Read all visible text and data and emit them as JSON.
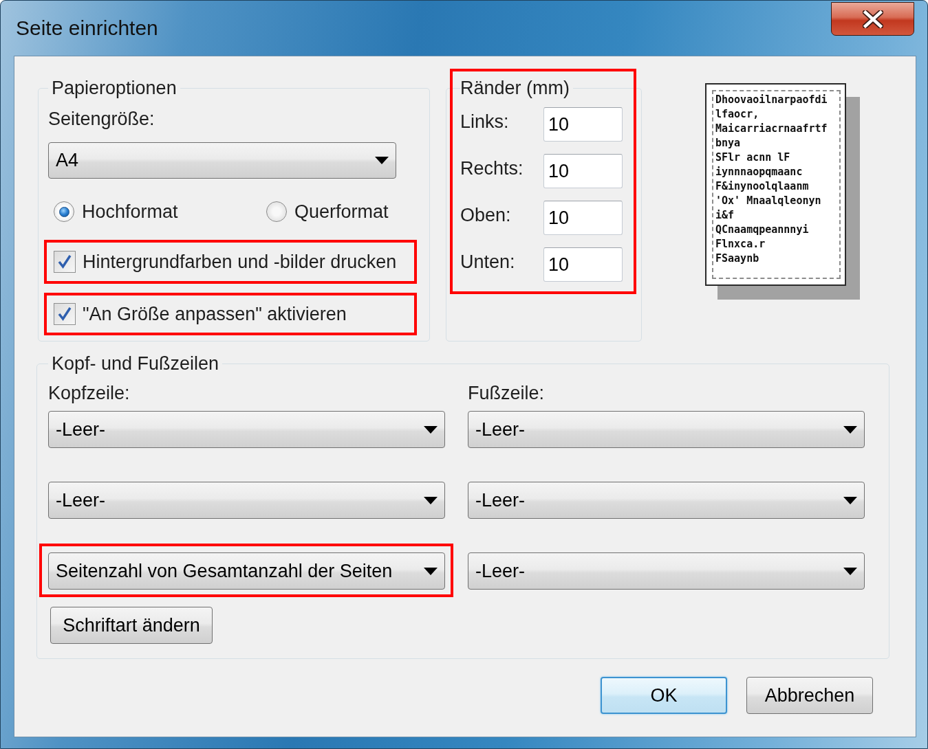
{
  "window": {
    "title": "Seite einrichten"
  },
  "paper_options": {
    "legend": "Papieroptionen",
    "page_size_label": "Seitengröße:",
    "page_size": {
      "value": "A4"
    },
    "orientation": [
      {
        "label": "Hochformat",
        "selected": true
      },
      {
        "label": "Querformat",
        "selected": false
      }
    ],
    "options": [
      {
        "label": "Hintergrundfarben und -bilder drucken",
        "checked": true,
        "highlighted": true
      },
      {
        "label": "\"An Größe anpassen\" aktivieren",
        "checked": true,
        "highlighted": true
      }
    ]
  },
  "margins": {
    "legend": "Ränder (mm)",
    "highlighted": true,
    "fields": [
      {
        "label": "Links:",
        "value": "10"
      },
      {
        "label": "Rechts:",
        "value": "10"
      },
      {
        "label": "Oben:",
        "value": "10"
      },
      {
        "label": "Unten:",
        "value": "10"
      }
    ]
  },
  "preview": {
    "lines": [
      "Dhoovaoilnarpaofdi",
      "lfaocr,",
      "Maicarriacrnaafrtf",
      "bnya",
      "SFlr acnn lF",
      "iynnnaopqmaanc",
      "F&inynoolqlaanm",
      "'Ox' Mnaalqleonyn",
      "i&f",
      "QCnaamqpeannnyi",
      "Flnxca.r",
      "FSaaynb"
    ]
  },
  "header_footer": {
    "legend": "Kopf- und Fußzeilen",
    "header_label": "Kopfzeile:",
    "footer_label": "Fußzeile:",
    "header": [
      {
        "value": "-Leer-",
        "highlighted": false
      },
      {
        "value": "-Leer-",
        "highlighted": false
      },
      {
        "value": "Seitenzahl von Gesamtanzahl der Seiten",
        "highlighted": true
      }
    ],
    "footer": [
      {
        "value": "-Leer-",
        "highlighted": false
      },
      {
        "value": "-Leer-",
        "highlighted": false
      },
      {
        "value": "-Leer-",
        "highlighted": false
      }
    ],
    "font_button": "Schriftart ändern"
  },
  "buttons": [
    {
      "label": "OK",
      "default": true
    },
    {
      "label": "Abbrechen",
      "default": false
    }
  ]
}
